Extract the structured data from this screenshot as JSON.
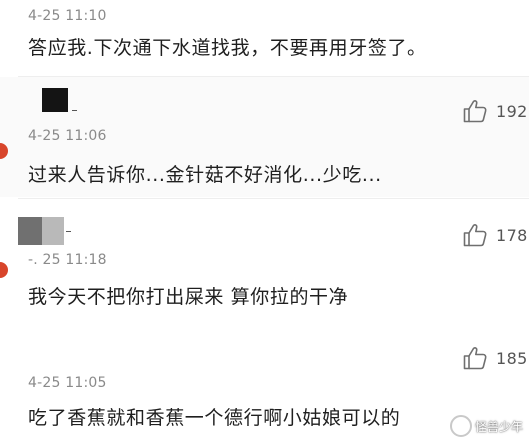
{
  "comments": [
    {
      "time": "4-25 11:10",
      "text": "答应我.下次通下水道找我，不要再用牙签了。"
    },
    {
      "time": "4-25 11:06",
      "text": "过来人告诉你...金针菇不好消化...少吃...",
      "likes": "192",
      "like_icon": "thumbs-up-icon"
    },
    {
      "time": "-. 25 11:18",
      "text": "我今天不把你打出屎来   算你拉的干净",
      "likes": "178",
      "like_icon": "thumbs-up-icon"
    },
    {
      "time": "4-25 11:05",
      "text": "吃了香蕉就和香蕉一个德行啊小姑娘可以的",
      "likes": "185",
      "like_icon": "thumbs-up-icon"
    }
  ],
  "watermark": {
    "text": "怪兽少年",
    "icon": "wechat-logo-icon"
  },
  "colors": {
    "timestamp": "#8a8a8a",
    "text": "#1f1f1f",
    "like_count": "#555555",
    "edge_dot": "#d8452b"
  }
}
